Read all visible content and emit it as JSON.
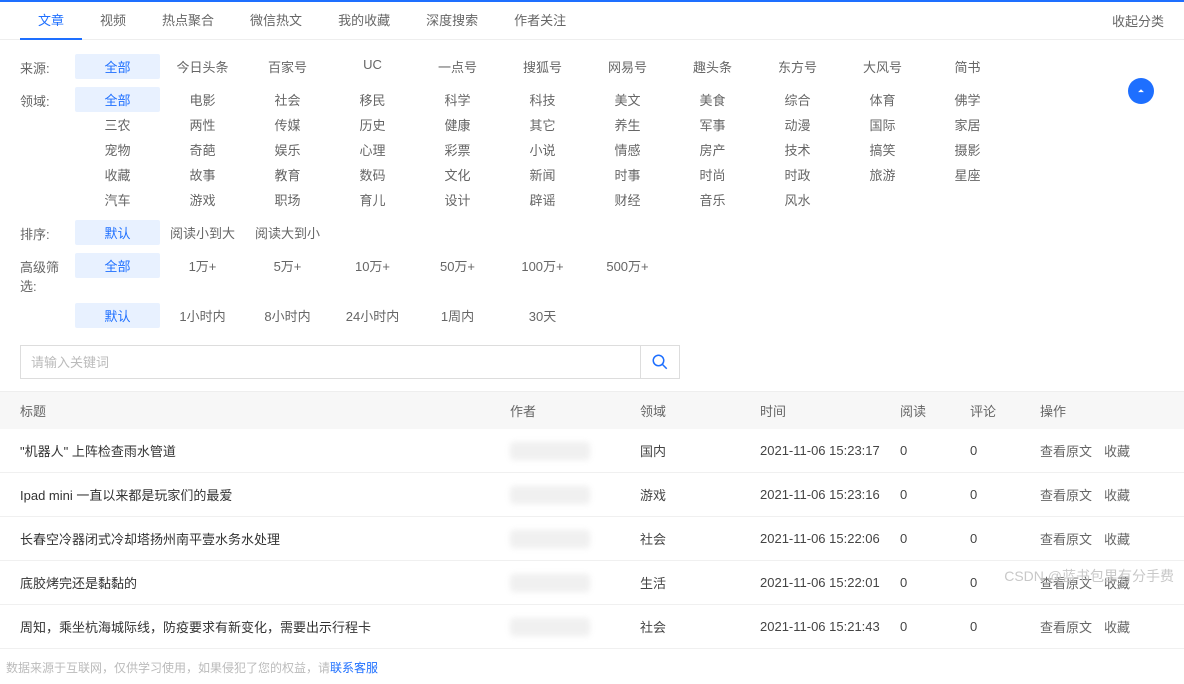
{
  "tabs": {
    "items": [
      "文章",
      "视频",
      "热点聚合",
      "微信热文",
      "我的收藏",
      "深度搜索",
      "作者关注"
    ],
    "active": 0,
    "collapse": "收起分类"
  },
  "filters": {
    "source": {
      "label": "来源:",
      "all": "全部",
      "items": [
        "今日头条",
        "百家号",
        "UC",
        "一点号",
        "搜狐号",
        "网易号",
        "趣头条",
        "东方号",
        "大风号",
        "简书"
      ]
    },
    "domain": {
      "label": "领域:",
      "all": "全部",
      "items": [
        "电影",
        "社会",
        "移民",
        "科学",
        "科技",
        "美文",
        "美食",
        "综合",
        "体育",
        "佛学",
        "三农",
        "两性",
        "传媒",
        "历史",
        "健康",
        "其它",
        "养生",
        "军事",
        "动漫",
        "国际",
        "家居",
        "宠物",
        "奇葩",
        "娱乐",
        "心理",
        "彩票",
        "小说",
        "情感",
        "房产",
        "技术",
        "搞笑",
        "摄影",
        "收藏",
        "故事",
        "教育",
        "数码",
        "文化",
        "新闻",
        "时事",
        "时尚",
        "时政",
        "旅游",
        "星座",
        "汽车",
        "游戏",
        "职场",
        "育儿",
        "设计",
        "辟谣",
        "财经",
        "音乐",
        "风水"
      ]
    },
    "sort": {
      "label": "排序:",
      "default": "默认",
      "items": [
        "阅读小到大",
        "阅读大到小"
      ]
    },
    "adv": {
      "label": "高级筛选:",
      "all": "全部",
      "row1": [
        "1万+",
        "5万+",
        "10万+",
        "50万+",
        "100万+",
        "500万+"
      ],
      "default": "默认",
      "row2": [
        "1小时内",
        "8小时内",
        "24小时内",
        "1周内",
        "30天"
      ]
    }
  },
  "search": {
    "placeholder": "请输入关键词"
  },
  "table": {
    "headers": {
      "title": "标题",
      "author": "作者",
      "domain": "领域",
      "time": "时间",
      "read": "阅读",
      "comment": "评论",
      "action": "操作"
    },
    "actions": {
      "view": "查看原文",
      "fav": "收藏"
    },
    "rows": [
      {
        "title": "\"机器人\" 上阵检查雨水管道",
        "domain": "国内",
        "time": "2021-11-06 15:23:17",
        "read": "0",
        "comment": "0"
      },
      {
        "title": "Ipad mini 一直以来都是玩家们的最爱",
        "domain": "游戏",
        "time": "2021-11-06 15:23:16",
        "read": "0",
        "comment": "0"
      },
      {
        "title": "长春空冷器闭式冷却塔扬州南平壹水务水处理",
        "domain": "社会",
        "time": "2021-11-06 15:22:06",
        "read": "0",
        "comment": "0"
      },
      {
        "title": "底胶烤完还是黏黏的",
        "domain": "生活",
        "time": "2021-11-06 15:22:01",
        "read": "0",
        "comment": "0"
      },
      {
        "title": "周知，乘坐杭海城际线，防疫要求有新变化，需要出示行程卡",
        "domain": "社会",
        "time": "2021-11-06 15:21:43",
        "read": "0",
        "comment": "0"
      }
    ]
  },
  "footer": {
    "text": "数据来源于互联网，仅供学习使用，如果侵犯了您的权益，请 ",
    "link": "联系客服"
  },
  "watermark": "CSDN @蓝书包里有分手费"
}
